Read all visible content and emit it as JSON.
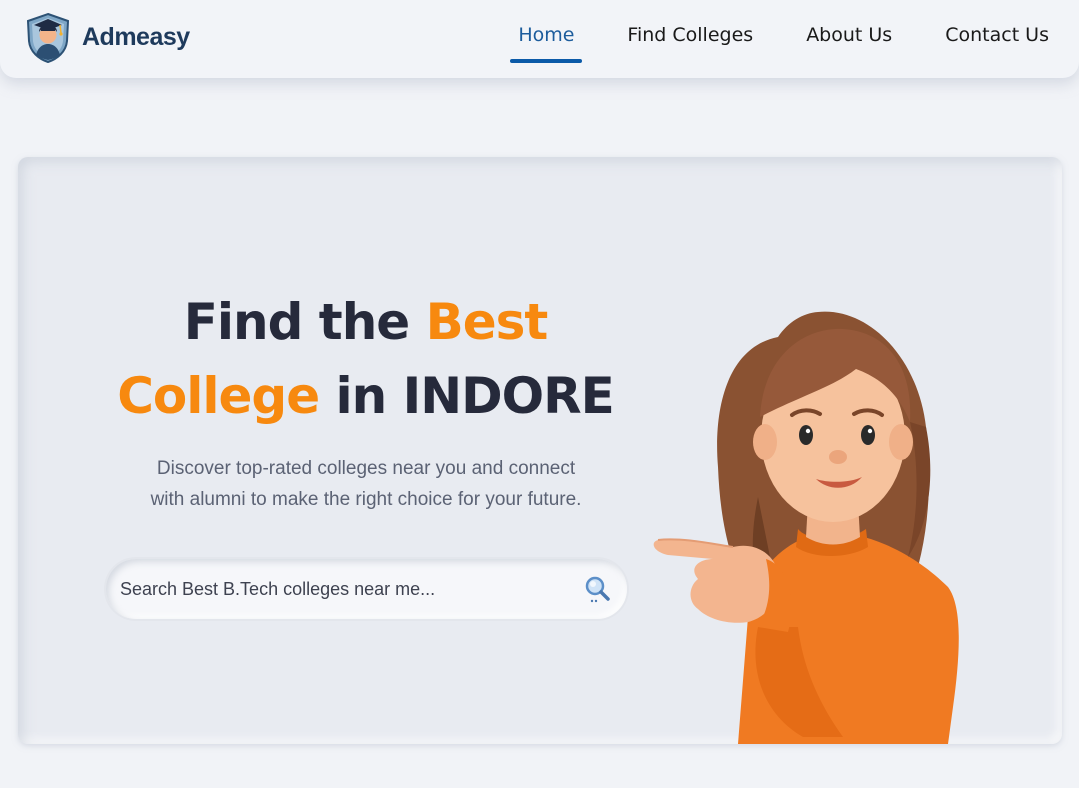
{
  "brand": {
    "name": "Admeasy",
    "icon": "graduate-shield-icon"
  },
  "nav": {
    "items": [
      {
        "label": "Home",
        "active": true
      },
      {
        "label": "Find Colleges",
        "active": false
      },
      {
        "label": "About Us",
        "active": false
      },
      {
        "label": "Contact Us",
        "active": false
      }
    ]
  },
  "hero": {
    "headline_part1": "Find the ",
    "headline_accent1": "Best",
    "headline_accent2": "College",
    "headline_part2": " in INDORE",
    "subtitle_line1": "Discover top-rated colleges near you and connect",
    "subtitle_line2": "with alumni to make the right choice for your future.",
    "search_placeholder": "Search Best B.Tech colleges near me...",
    "search_icon": "magnifier-icon",
    "illustration": "girl-pointing-illustration"
  },
  "colors": {
    "accent": "#f7890f",
    "brand_dark": "#1e3a5c",
    "nav_active": "#0b5aa8",
    "heading": "#262a3b",
    "background": "#f1f3f7"
  }
}
